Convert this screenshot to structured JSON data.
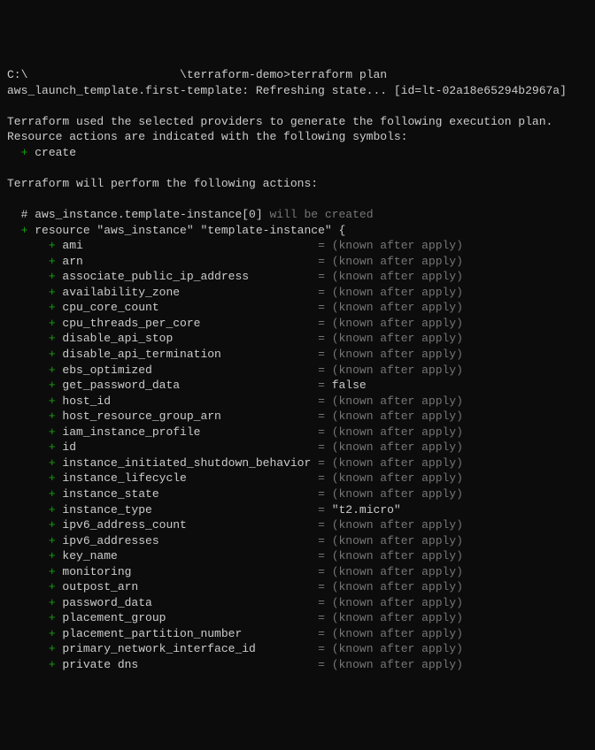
{
  "prompt_prefix": "C:\\",
  "prompt_hidden": "                      ",
  "prompt_suffix": "\\terraform-demo>",
  "command": "terraform plan",
  "refresh_line": "aws_launch_template.first-template: Refreshing state... [id=lt-02a18e65294b2967a]",
  "intro_line1": "Terraform used the selected providers to generate the following execution plan.",
  "intro_line2": "Resource actions are indicated with the following symbols:",
  "create_symbol": "  + ",
  "create_word": "create",
  "will_perform": "Terraform will perform the following actions:",
  "resource_comment_prefix": "  # ",
  "resource_comment_name": "aws_instance.template-instance[0]",
  "resource_comment_suffix": " will be created",
  "resource_open_plus": "  + ",
  "resource_open_text": "resource \"aws_instance\" \"template-instance\" {",
  "known_after_apply": "(known after apply)",
  "attrs": [
    {
      "name": "ami",
      "value": "(known after apply)"
    },
    {
      "name": "arn",
      "value": "(known after apply)"
    },
    {
      "name": "associate_public_ip_address",
      "value": "(known after apply)"
    },
    {
      "name": "availability_zone",
      "value": "(known after apply)"
    },
    {
      "name": "cpu_core_count",
      "value": "(known after apply)"
    },
    {
      "name": "cpu_threads_per_core",
      "value": "(known after apply)"
    },
    {
      "name": "disable_api_stop",
      "value": "(known after apply)"
    },
    {
      "name": "disable_api_termination",
      "value": "(known after apply)"
    },
    {
      "name": "ebs_optimized",
      "value": "(known after apply)"
    },
    {
      "name": "get_password_data",
      "value": "false"
    },
    {
      "name": "host_id",
      "value": "(known after apply)"
    },
    {
      "name": "host_resource_group_arn",
      "value": "(known after apply)"
    },
    {
      "name": "iam_instance_profile",
      "value": "(known after apply)"
    },
    {
      "name": "id",
      "value": "(known after apply)"
    },
    {
      "name": "instance_initiated_shutdown_behavior",
      "value": "(known after apply)"
    },
    {
      "name": "instance_lifecycle",
      "value": "(known after apply)"
    },
    {
      "name": "instance_state",
      "value": "(known after apply)"
    },
    {
      "name": "instance_type",
      "value": "\"t2.micro\""
    },
    {
      "name": "ipv6_address_count",
      "value": "(known after apply)"
    },
    {
      "name": "ipv6_addresses",
      "value": "(known after apply)"
    },
    {
      "name": "key_name",
      "value": "(known after apply)"
    },
    {
      "name": "monitoring",
      "value": "(known after apply)"
    },
    {
      "name": "outpost_arn",
      "value": "(known after apply)"
    },
    {
      "name": "password_data",
      "value": "(known after apply)"
    },
    {
      "name": "placement_group",
      "value": "(known after apply)"
    },
    {
      "name": "placement_partition_number",
      "value": "(known after apply)"
    },
    {
      "name": "primary_network_interface_id",
      "value": "(known after apply)"
    },
    {
      "name": "private dns",
      "value": "(known after apply)"
    }
  ],
  "name_col_width": 37
}
